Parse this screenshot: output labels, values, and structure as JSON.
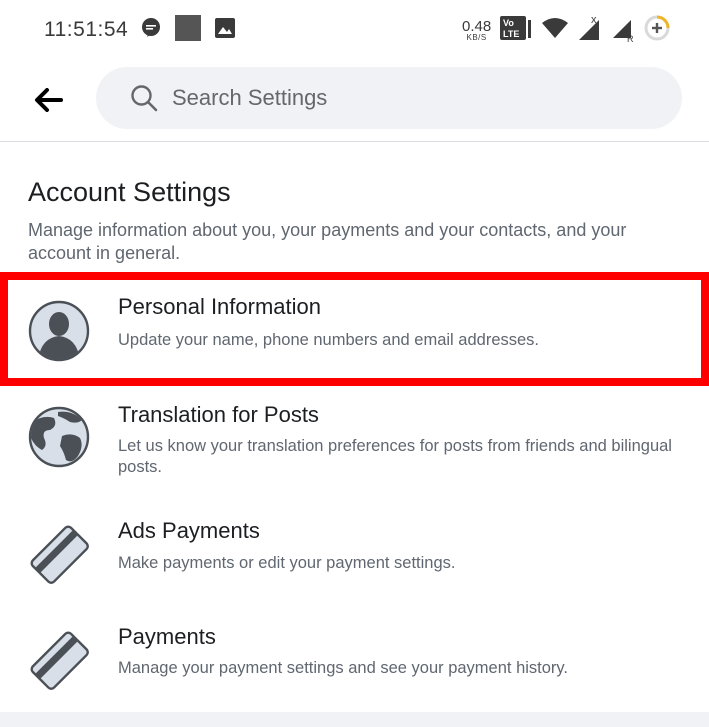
{
  "status_bar": {
    "time": "11:51:54",
    "net_speed_value": "0.48",
    "net_speed_unit": "KB/S",
    "volte_label": "Vo LTE",
    "icons": [
      "chat-bubble-icon",
      "square-notification-icon",
      "image-icon",
      "volte-icon",
      "wifi-icon",
      "signal-icon",
      "signal-roaming-icon",
      "battery-charging-icon"
    ]
  },
  "header": {
    "back_icon": "arrow-left-icon",
    "search_placeholder": "Search Settings"
  },
  "section": {
    "title": "Account Settings",
    "description": "Manage information about you, your payments and your contacts, and your account in general."
  },
  "items": [
    {
      "icon": "person-icon",
      "title": "Personal Information",
      "subtitle": "Update your name, phone numbers and email addresses.",
      "highlighted": true
    },
    {
      "icon": "globe-icon",
      "title": "Translation for Posts",
      "subtitle": "Let us know your translation preferences for posts from friends and bilingual posts."
    },
    {
      "icon": "credit-card-icon",
      "title": "Ads Payments",
      "subtitle": "Make payments or edit your payment settings."
    },
    {
      "icon": "credit-card-icon",
      "title": "Payments",
      "subtitle": "Manage your payment settings and see your payment history."
    }
  ],
  "colors": {
    "highlight": "#ff0000",
    "icon_fill": "#d8dfe8",
    "icon_dark": "#4b4f56",
    "search_bg": "#f0f2f5"
  }
}
